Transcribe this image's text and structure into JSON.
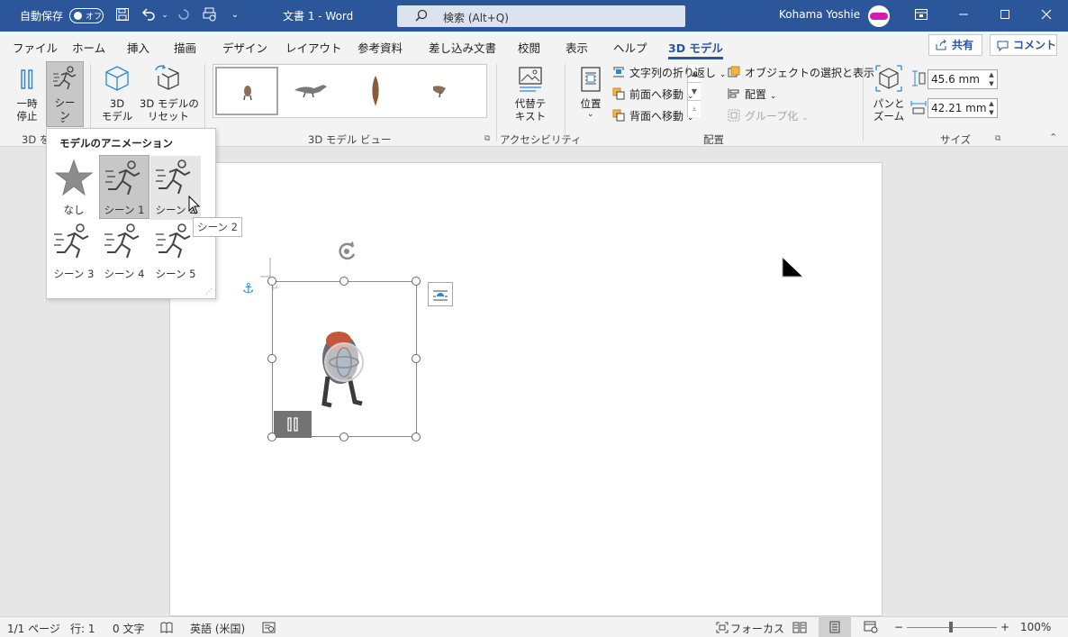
{
  "titlebar": {
    "autosave_label": "自動保存",
    "autosave_state": "オフ",
    "doc_title": "文書 1  -  Word",
    "search_placeholder": "検索 (Alt+Q)",
    "user_name": "Kohama Yoshie",
    "accent": "#2b579a"
  },
  "tabs": [
    "ファイル",
    "ホーム",
    "挿入",
    "描画",
    "デザイン",
    "レイアウト",
    "参考資料",
    "差し込み文書",
    "校閲",
    "表示",
    "ヘルプ",
    "3D モデル"
  ],
  "active_tab": "3D モデル",
  "share_label": "共有",
  "comment_label": "コメント",
  "ribbon": {
    "pause_label": "一時\n停止",
    "scene_label": "シー\nン",
    "model_label": "3D\nモデル",
    "reset_label": "3D モデルの\nリセット",
    "group1_label": "3D を",
    "gallery_group_label": "3D モデル ビュー",
    "alt_text_label": "代替テ\nキスト",
    "accessibility_label": "アクセシビリティ",
    "position_label": "位置",
    "wrap_text_label": "文字列の折り返し",
    "bring_forward_label": "前面へ移動",
    "send_backward_label": "背面へ移動",
    "selection_pane_label": "オブジェクトの選択と表示",
    "align_label": "配置",
    "group_label": "グループ化",
    "arrange_group_label": "配置",
    "pan_zoom_label": "パンと\nズーム",
    "height_value": "45.6 mm",
    "width_value": "42.21 mm",
    "size_group_label": "サイズ"
  },
  "dropdown": {
    "header": "モデルのアニメーション",
    "items": [
      "なし",
      "シーン 1",
      "シーン 2",
      "シーン 3",
      "シーン 4",
      "シーン 5"
    ],
    "selected": "シーン 1",
    "hovered": "シーン 2"
  },
  "tooltip": "シーン 2",
  "statusbar": {
    "page": "1/1 ページ",
    "line": "行: 1",
    "chars": "0 文字",
    "language": "英語 (米国)",
    "focus": "フォーカス",
    "zoom": "100%",
    "zoom_minus": "−",
    "zoom_plus": "+"
  }
}
